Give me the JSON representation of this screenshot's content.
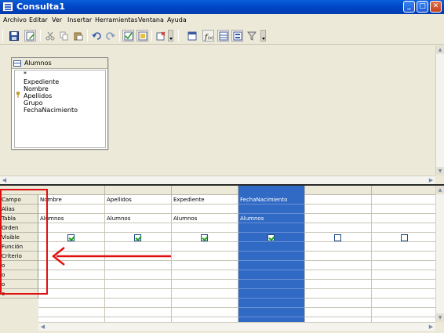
{
  "window": {
    "title": "Consulta1",
    "buttons": {
      "minimize": "_",
      "maximize": "□",
      "close": "✕"
    }
  },
  "menu": [
    "Archivo",
    "Editar",
    "Ver",
    "Insertar",
    "Herramientas",
    "Ventana",
    "Ayuda"
  ],
  "toolbar": {
    "icons": [
      "save-icon",
      "edit-mode-icon",
      "cut-icon",
      "copy-icon",
      "paste-icon",
      "undo-icon",
      "redo-icon",
      "run-query-icon",
      "clear-query-icon",
      "add-table-icon",
      "functions-icon",
      "table-name-icon",
      "alias-icon",
      "distinct-values-icon"
    ]
  },
  "table_window": {
    "name": "Alumnos",
    "fields": [
      "*",
      "Expediente",
      "Nombre",
      "Apellidos",
      "Grupo",
      "FechaNacimiento"
    ],
    "primary_key": "Expediente"
  },
  "grid": {
    "row_labels": [
      "Campo",
      "Alias",
      "Tabla",
      "Orden",
      "Visible",
      "Función",
      "Criterio",
      "o",
      "o",
      "o",
      "o"
    ],
    "columns": [
      {
        "field": "Nombre",
        "alias": "",
        "table": "Alumnos",
        "visible": true,
        "selected": false
      },
      {
        "field": "Apellidos",
        "alias": "",
        "table": "Alumnos",
        "visible": true,
        "selected": false
      },
      {
        "field": "Expediente",
        "alias": "",
        "table": "Alumnos",
        "visible": true,
        "selected": false
      },
      {
        "field": "FechaNacimiento",
        "alias": "",
        "table": "Alumnos",
        "visible": true,
        "selected": true
      },
      {
        "field": "",
        "alias": "",
        "table": "",
        "visible": false,
        "selected": false
      },
      {
        "field": "",
        "alias": "",
        "table": "",
        "visible": false,
        "selected": false
      }
    ]
  },
  "colors": {
    "titlebar": "#0047c8",
    "selection": "#316ac5",
    "annotation": "#e01010",
    "checkmark": "#21a121"
  }
}
